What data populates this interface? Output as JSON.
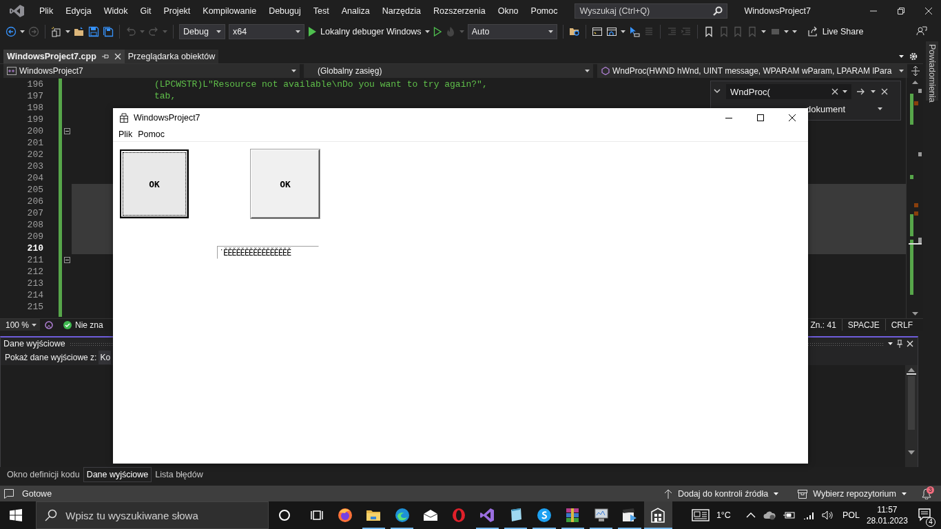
{
  "menu_bar": {
    "items": [
      "Plik",
      "Edycja",
      "Widok",
      "Git",
      "Projekt",
      "Kompilowanie",
      "Debuguj",
      "Test",
      "Analiza",
      "Narzędzia",
      "Rozszerzenia",
      "Okno",
      "Pomoc"
    ],
    "search": {
      "placeholder": "Wyszukaj (Ctrl+Q)"
    },
    "solution_name": "WindowsProject7"
  },
  "toolbar": {
    "configuration": "Debug",
    "platform": "x64",
    "debugger": "Lokalny debuger Windows",
    "solution_platform": "Auto",
    "live_share": "Live Share"
  },
  "document_tabs": [
    {
      "label": "WindowsProject7.cpp",
      "selected": true
    },
    {
      "label": "Przeglądarka obiektów",
      "selected": false
    }
  ],
  "navigation_bar": {
    "project": "WindowsProject7",
    "scope": "(Globalny zasięg)",
    "member": "WndProc(HWND hWnd, UINT message, WPARAM wParam, LPARAM lPara"
  },
  "editor": {
    "lines": [
      {
        "number": "196",
        "code": "(LPCWSTR)L\"Resource not available\\nDo you want to try again?\",",
        "current": false,
        "foldable": false,
        "highlighted": false
      },
      {
        "number": "197",
        "code": "tab,",
        "current": false,
        "foldable": false,
        "highlighted": false
      },
      {
        "number": "198",
        "current": false,
        "foldable": false,
        "highlighted": false
      },
      {
        "number": "199",
        "current": false,
        "foldable": false,
        "highlighted": false
      },
      {
        "number": "200",
        "current": false,
        "foldable": true,
        "highlighted": false
      },
      {
        "number": "201",
        "current": false,
        "foldable": false,
        "highlighted": false
      },
      {
        "number": "202",
        "current": false,
        "foldable": false,
        "highlighted": false
      },
      {
        "number": "203",
        "current": false,
        "foldable": false,
        "highlighted": false
      },
      {
        "number": "204",
        "current": false,
        "foldable": false,
        "highlighted": false
      },
      {
        "number": "205",
        "current": false,
        "foldable": false,
        "highlighted": true
      },
      {
        "number": "206",
        "current": false,
        "foldable": false,
        "highlighted": true
      },
      {
        "number": "207",
        "current": false,
        "foldable": false,
        "highlighted": true
      },
      {
        "number": "208",
        "current": false,
        "foldable": false,
        "highlighted": true
      },
      {
        "number": "209",
        "current": false,
        "foldable": false,
        "highlighted": true
      },
      {
        "number": "210",
        "current": true,
        "foldable": false,
        "highlighted": true
      },
      {
        "number": "211",
        "current": false,
        "foldable": true,
        "highlighted": false
      },
      {
        "number": "212",
        "current": false,
        "foldable": false,
        "highlighted": false
      },
      {
        "number": "213",
        "current": false,
        "foldable": false,
        "highlighted": false
      },
      {
        "number": "214",
        "current": false,
        "foldable": false,
        "highlighted": false
      },
      {
        "number": "215",
        "current": false,
        "foldable": false,
        "highlighted": false
      }
    ],
    "find": {
      "value": "WndProc(",
      "scope": "dokument"
    }
  },
  "editor_status": {
    "zoom": "100 %",
    "issues": "Nie zna",
    "column": "Zn.: 41",
    "indent": "SPACJE",
    "line_endings": "CRLF"
  },
  "output_panel": {
    "title": "Dane wyjściowe",
    "source_label": "Pokaż dane wyjściowe z:",
    "source_value": "Ko"
  },
  "bottom_tabs": [
    {
      "label": "Okno definicji kodu",
      "selected": false
    },
    {
      "label": "Dane wyjściowe",
      "selected": true
    },
    {
      "label": "Lista błędów",
      "selected": false
    }
  ],
  "status_bar": {
    "message": "Gotowe",
    "source_control": "Dodaj do kontroli źródła",
    "repository": "Wybierz repozytorium",
    "notifications": "3"
  },
  "notifications_strip": "Powiadomienia",
  "app_window": {
    "title": "WindowsProject7",
    "menu": [
      "Plik",
      "Pomoc"
    ],
    "buttons": [
      {
        "label": "OK",
        "kind": "default"
      },
      {
        "label": "OK",
        "kind": "plain"
      }
    ],
    "edit_value": "˙ĚĚĚĚĚĚĚĚĚĚĚĚĚĚĚĚ"
  },
  "taskbar": {
    "search": {
      "placeholder": "Wpisz tu wyszukiwane słowa"
    },
    "apps": [
      {
        "kind": "fox",
        "running": false,
        "selected": false
      },
      {
        "kind": "folder",
        "running": true,
        "selected": false
      },
      {
        "kind": "wave",
        "running": true,
        "selected": false
      },
      {
        "kind": "mail",
        "running": false,
        "selected": false
      },
      {
        "kind": "ring",
        "running": false,
        "selected": false
      },
      {
        "kind": "ribbon",
        "running": true,
        "selected": false
      },
      {
        "kind": "notepad",
        "running": true,
        "selected": false
      },
      {
        "kind": "chat",
        "running": true,
        "selected": false
      },
      {
        "kind": "stack",
        "running": true,
        "selected": false
      },
      {
        "kind": "monitor",
        "running": true,
        "selected": false
      },
      {
        "kind": "clapper",
        "running": true,
        "selected": false
      },
      {
        "kind": "building",
        "running": true,
        "selected": true
      }
    ],
    "weather": "1°C",
    "language": "POL",
    "time": "11:57",
    "date": "28.01.2023",
    "notifications": "4"
  }
}
